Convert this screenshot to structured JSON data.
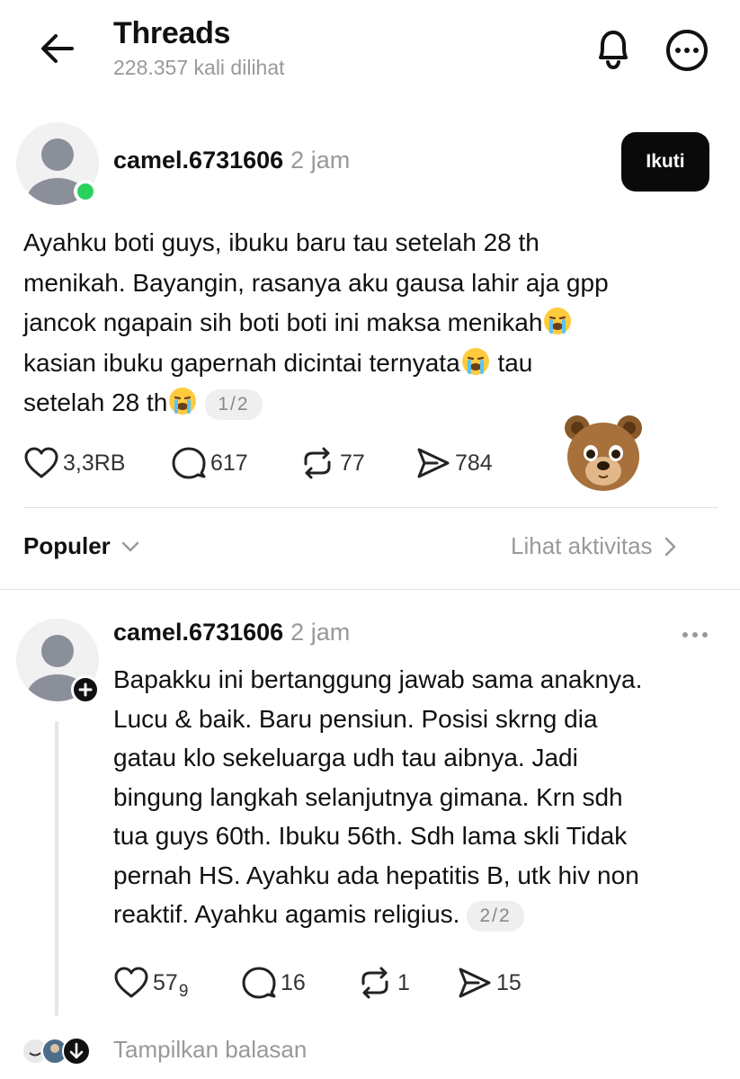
{
  "header": {
    "title": "Threads",
    "views": "228.357 kali dilihat"
  },
  "post": {
    "username": "camel.6731606",
    "time": "2 jam",
    "follow_label": "Ikuti",
    "lines": [
      "Ayahku boti guys, ibuku baru tau setelah 28 th",
      "menikah. Bayangin, rasanya aku gausa lahir aja gpp",
      "jancok ngapain sih boti boti ini maksa menikah",
      "kasian ibuku gapernah dicintai ternyata",
      "tau",
      "setelah 28 th"
    ],
    "pager": "1/2",
    "likes": "3,3RB",
    "comments": "617",
    "reposts": "77",
    "shares": "784"
  },
  "sort": {
    "label": "Populer",
    "activity_link": "Lihat aktivitas"
  },
  "reply": {
    "username": "camel.6731606",
    "time": "2 jam",
    "lines": [
      "Bapakku ini bertanggung jawab sama anaknya.",
      "Lucu & baik. Baru pensiun. Posisi skrng dia",
      "gatau klo sekeluarga udh tau aibnya. Jadi",
      "bingung langkah selanjutnya gimana. Krn sdh",
      "tua guys 60th. Ibuku 56th. Sdh lama skli Tidak",
      "pernah HS. Ayahku ada hepatitis B, utk hiv non",
      "reaktif. Ayahku agamis religius."
    ],
    "pager": "2/2",
    "likes": "57",
    "likes_sub": "9",
    "comments": "16",
    "reposts": "1",
    "shares": "15"
  },
  "footer": {
    "show_replies": "Tampilkan balasan"
  },
  "icons": {
    "back": "arrow-left-icon",
    "notify": "bell-icon",
    "more": "more-circle-icon",
    "like": "heart-icon",
    "comment": "comment-icon",
    "repost": "repost-icon",
    "share": "send-icon",
    "crying": "crying-face-emoji",
    "bear": "bear-face-emoji"
  },
  "colors": {
    "accent": "#0a0a0a",
    "online": "#2bd15d",
    "muted": "#999999"
  }
}
